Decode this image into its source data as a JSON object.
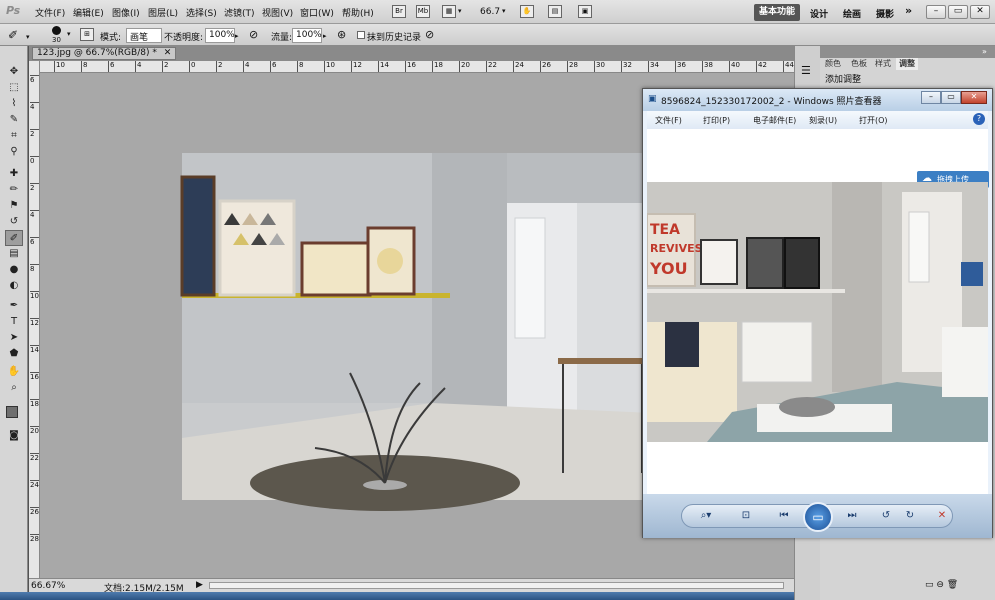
{
  "app": {
    "logo": "Ps"
  },
  "menu": [
    "文件(F)",
    "编辑(E)",
    "图像(I)",
    "图层(L)",
    "选择(S)",
    "滤镜(T)",
    "视图(V)",
    "窗口(W)",
    "帮助(H)"
  ],
  "menubar": {
    "mb_label": "Mb",
    "zoom_value": "66.7"
  },
  "workspaces": {
    "active": "基本功能",
    "design": "设计",
    "painting": "绘画",
    "photography": "摄影",
    "more": "»"
  },
  "window_controls": {
    "minimize": "–",
    "restore": "▭",
    "close": "✕"
  },
  "options": {
    "brush_size": "30",
    "mode_label": "模式:",
    "mode_value": "画笔",
    "opacity_label": "不透明度:",
    "opacity_value": "100%",
    "flow_label": "流量:",
    "flow_value": "100%",
    "erase_history_label": "抹到历史记录"
  },
  "document": {
    "tab_title": "123.jpg @ 66.7%(RGB/8) *",
    "zoom": "66.67%",
    "doc_info": "文档:2.15M/2.15M"
  },
  "rulers": {
    "horizontal": [
      "10",
      "8",
      "6",
      "4",
      "2",
      "0",
      "2",
      "4",
      "6",
      "8",
      "10",
      "12",
      "14",
      "16",
      "18",
      "20",
      "22",
      "24",
      "26",
      "28",
      "30",
      "32",
      "34",
      "36",
      "38",
      "40",
      "42",
      "44"
    ],
    "vertical": [
      "6",
      "4",
      "2",
      "0",
      "2",
      "4",
      "6",
      "8",
      "10",
      "12",
      "14",
      "16",
      "18",
      "20",
      "22",
      "24",
      "26",
      "28"
    ]
  },
  "panels": {
    "tabs": [
      "颜色",
      "色板",
      "样式",
      "调整"
    ],
    "active_tab": "调整",
    "add_adjustment": "添加调整"
  },
  "viewer": {
    "title": "8596824_152330172002_2 - Windows 照片查看器",
    "menu": [
      "文件(F)",
      "打印(P)",
      "电子邮件(E)",
      "刻录(U)",
      "打开(O)"
    ],
    "upload_button": "拖拽上传",
    "help": "?"
  },
  "colors": {
    "accent": "#3c7fc4",
    "ps_bg": "#535353",
    "panel_bg": "#d4d4d4"
  }
}
